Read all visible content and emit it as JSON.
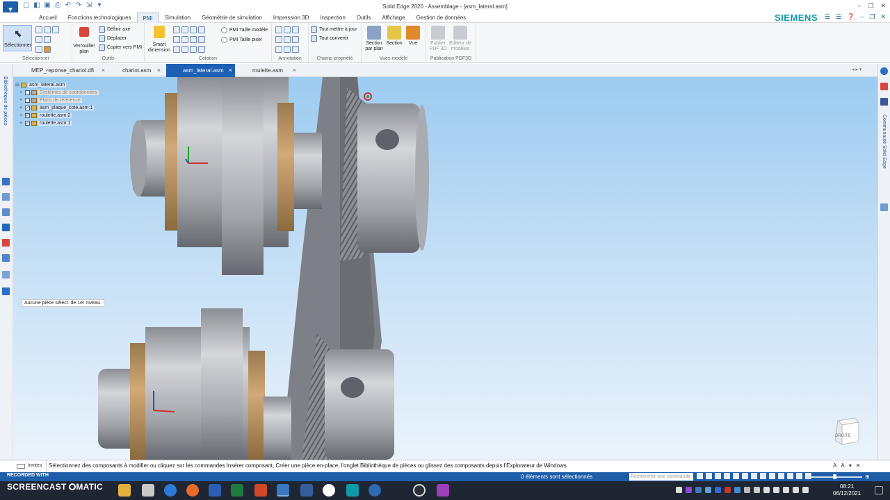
{
  "window": {
    "title": "Solid Edge 2020 - Assemblage - [asm_lateral.asm]",
    "brand": "SIEMENS"
  },
  "menu": {
    "tabs": [
      "Accueil",
      "Fonctions technologiques",
      "PMI",
      "Simulation",
      "Géométrie de simulation",
      "Impression 3D",
      "Inspection",
      "Outils",
      "Affichage",
      "Gestion de données"
    ],
    "active": "PMI"
  },
  "ribbon": {
    "select": {
      "label": "Sélectionner",
      "group": "Sélectionner"
    },
    "outils": {
      "lock_label_1": "Verrouiller",
      "lock_label_2": "plan",
      "define_axis": "Définir axe",
      "move": "Déplacer",
      "copy_to_plan": "Copier vers PMI",
      "group": "Outils"
    },
    "cotation": {
      "smart_1": "Smart",
      "smart_2": "dimension",
      "pmi_model_size": "PMI Taille modèle",
      "pmi_pixel_size": "PMI Taille pixel",
      "group": "Cotation"
    },
    "annotation": {
      "group": "Annotation"
    },
    "champ": {
      "update_all": "Tout mettre à jour",
      "convert_all": "Tout convertir",
      "group": "Champ propriété"
    },
    "vues": {
      "section_plan_1": "Section",
      "section_plan_2": "par plan",
      "section": "Section",
      "view": "Vue",
      "group": "Vues modèle"
    },
    "publication": {
      "publish_1": "Publier",
      "publish_2": "PDF 3D",
      "editor_1": "Editeur de",
      "editor_2": "modèles",
      "group": "Publication PDF3D"
    }
  },
  "doc_tabs": [
    {
      "label": "MEP_reponse_chariot.dft",
      "close": "×"
    },
    {
      "label": "chariot.asm",
      "close": "×"
    },
    {
      "label": "asm_lateral.asm",
      "close": "×"
    },
    {
      "label": "roulette.asm",
      "close": "×"
    }
  ],
  "left_panel_label": "Bibliothèque de pièces",
  "right_panel_label": "Communauté Solid Edge",
  "tree": {
    "root": "asm_lateral.asm",
    "items": [
      "Systèmes de coordonnées",
      "Plans de référence",
      "asm_plaque_cote.asm:1",
      "roulette.asm:2",
      "roulette.asm:1"
    ],
    "status": "Aucune pièce sélect. de 1er niveau."
  },
  "viewcube": {
    "label": "DROITE"
  },
  "command": {
    "label": "Invites",
    "prompt": "Sélectionnez des composants à modifier ou cliquez sur les commandes Insérer composant, Créer une pièce en-place, l'onglet Bibliothèque de pièces ou glissez des composants depuis l'Explorateur de Windows."
  },
  "status": {
    "recorded": "RECORDED WITH",
    "selection": "0 éléments sont sélectionnés",
    "search_placeholder": "Rechercher une commande"
  },
  "taskbar": {
    "screencast": "SCREENCAST",
    "matic": "MATIC",
    "time": "08:21",
    "date": "06/12/2021"
  },
  "colors": {
    "accent": "#1c5fb4",
    "brand": "#0f9aa8",
    "taskbar": "#1f2633"
  }
}
